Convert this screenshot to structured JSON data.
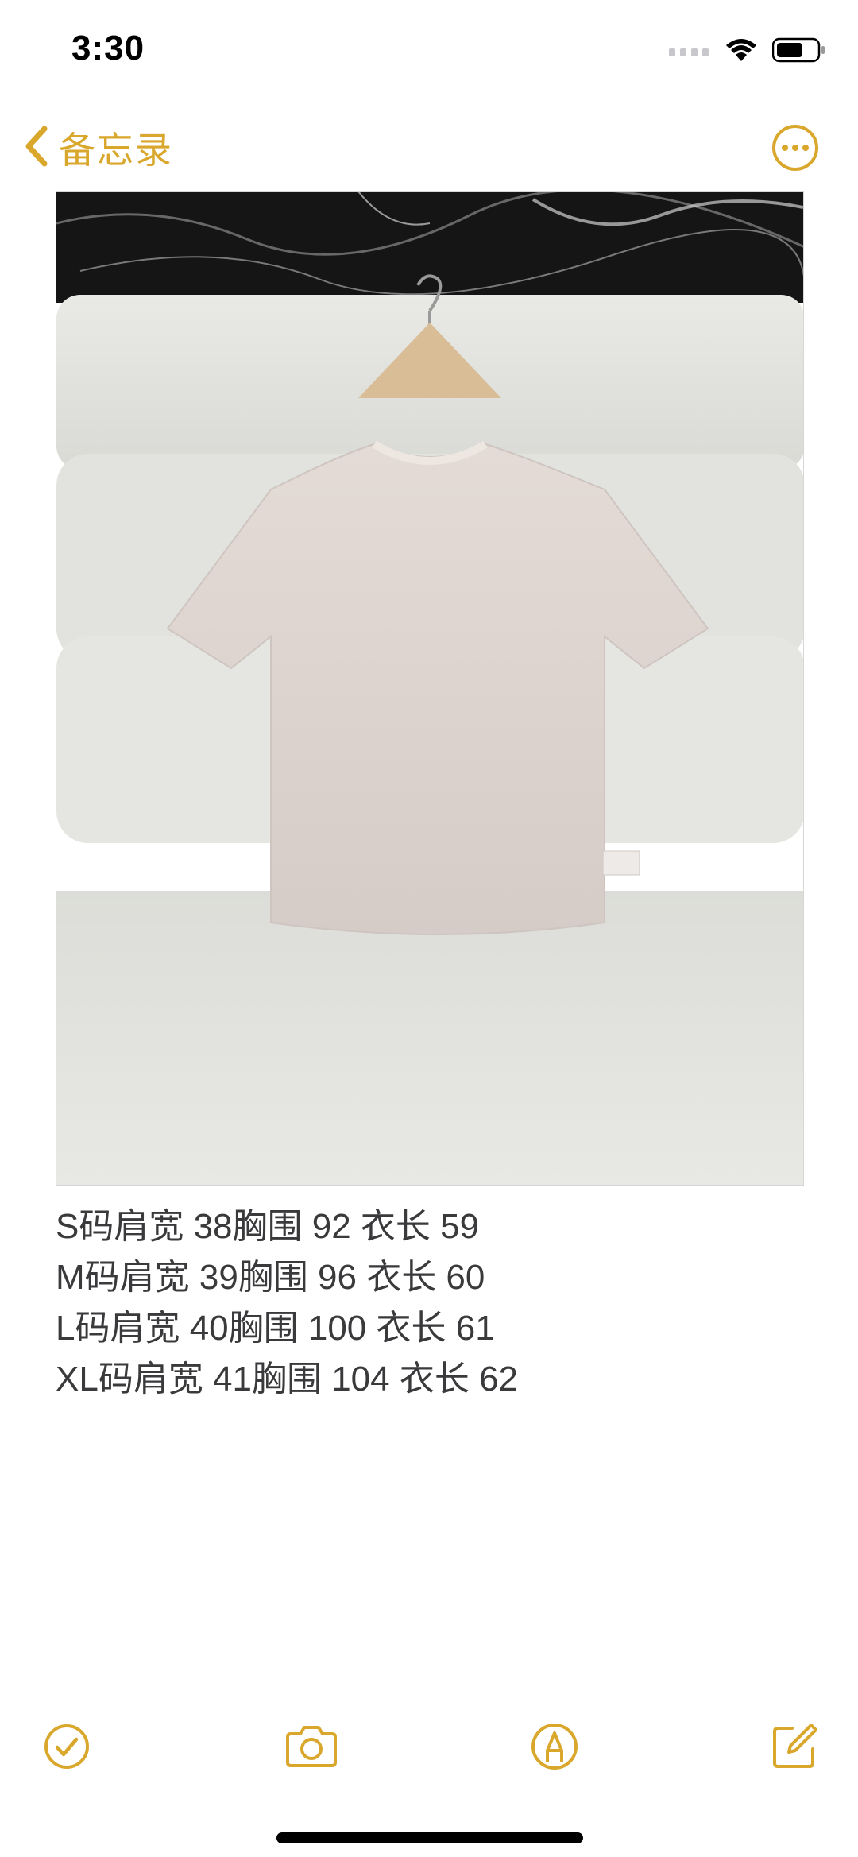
{
  "status_bar": {
    "time": "3:30",
    "icons": [
      "signal-icon",
      "wifi-icon",
      "battery-icon"
    ]
  },
  "nav": {
    "back_label": "备忘录",
    "back_icon": "chevron-left-icon",
    "more_icon": "ellipsis-circle-icon"
  },
  "note": {
    "image_subject": "photo",
    "lines": [
      "S码肩宽 38胸围 92 衣长 59",
      "M码肩宽 39胸围 96 衣长 60",
      "L码肩宽 40胸围 100 衣长 61",
      "XL码肩宽 41胸围 104 衣长 62"
    ]
  },
  "toolbar": {
    "items": [
      "checklist-icon",
      "camera-icon",
      "markup-pen-icon",
      "compose-icon"
    ]
  },
  "colors": {
    "accent": "#d9a72b",
    "text": "#3a3a3c",
    "background": "#ffffff"
  }
}
